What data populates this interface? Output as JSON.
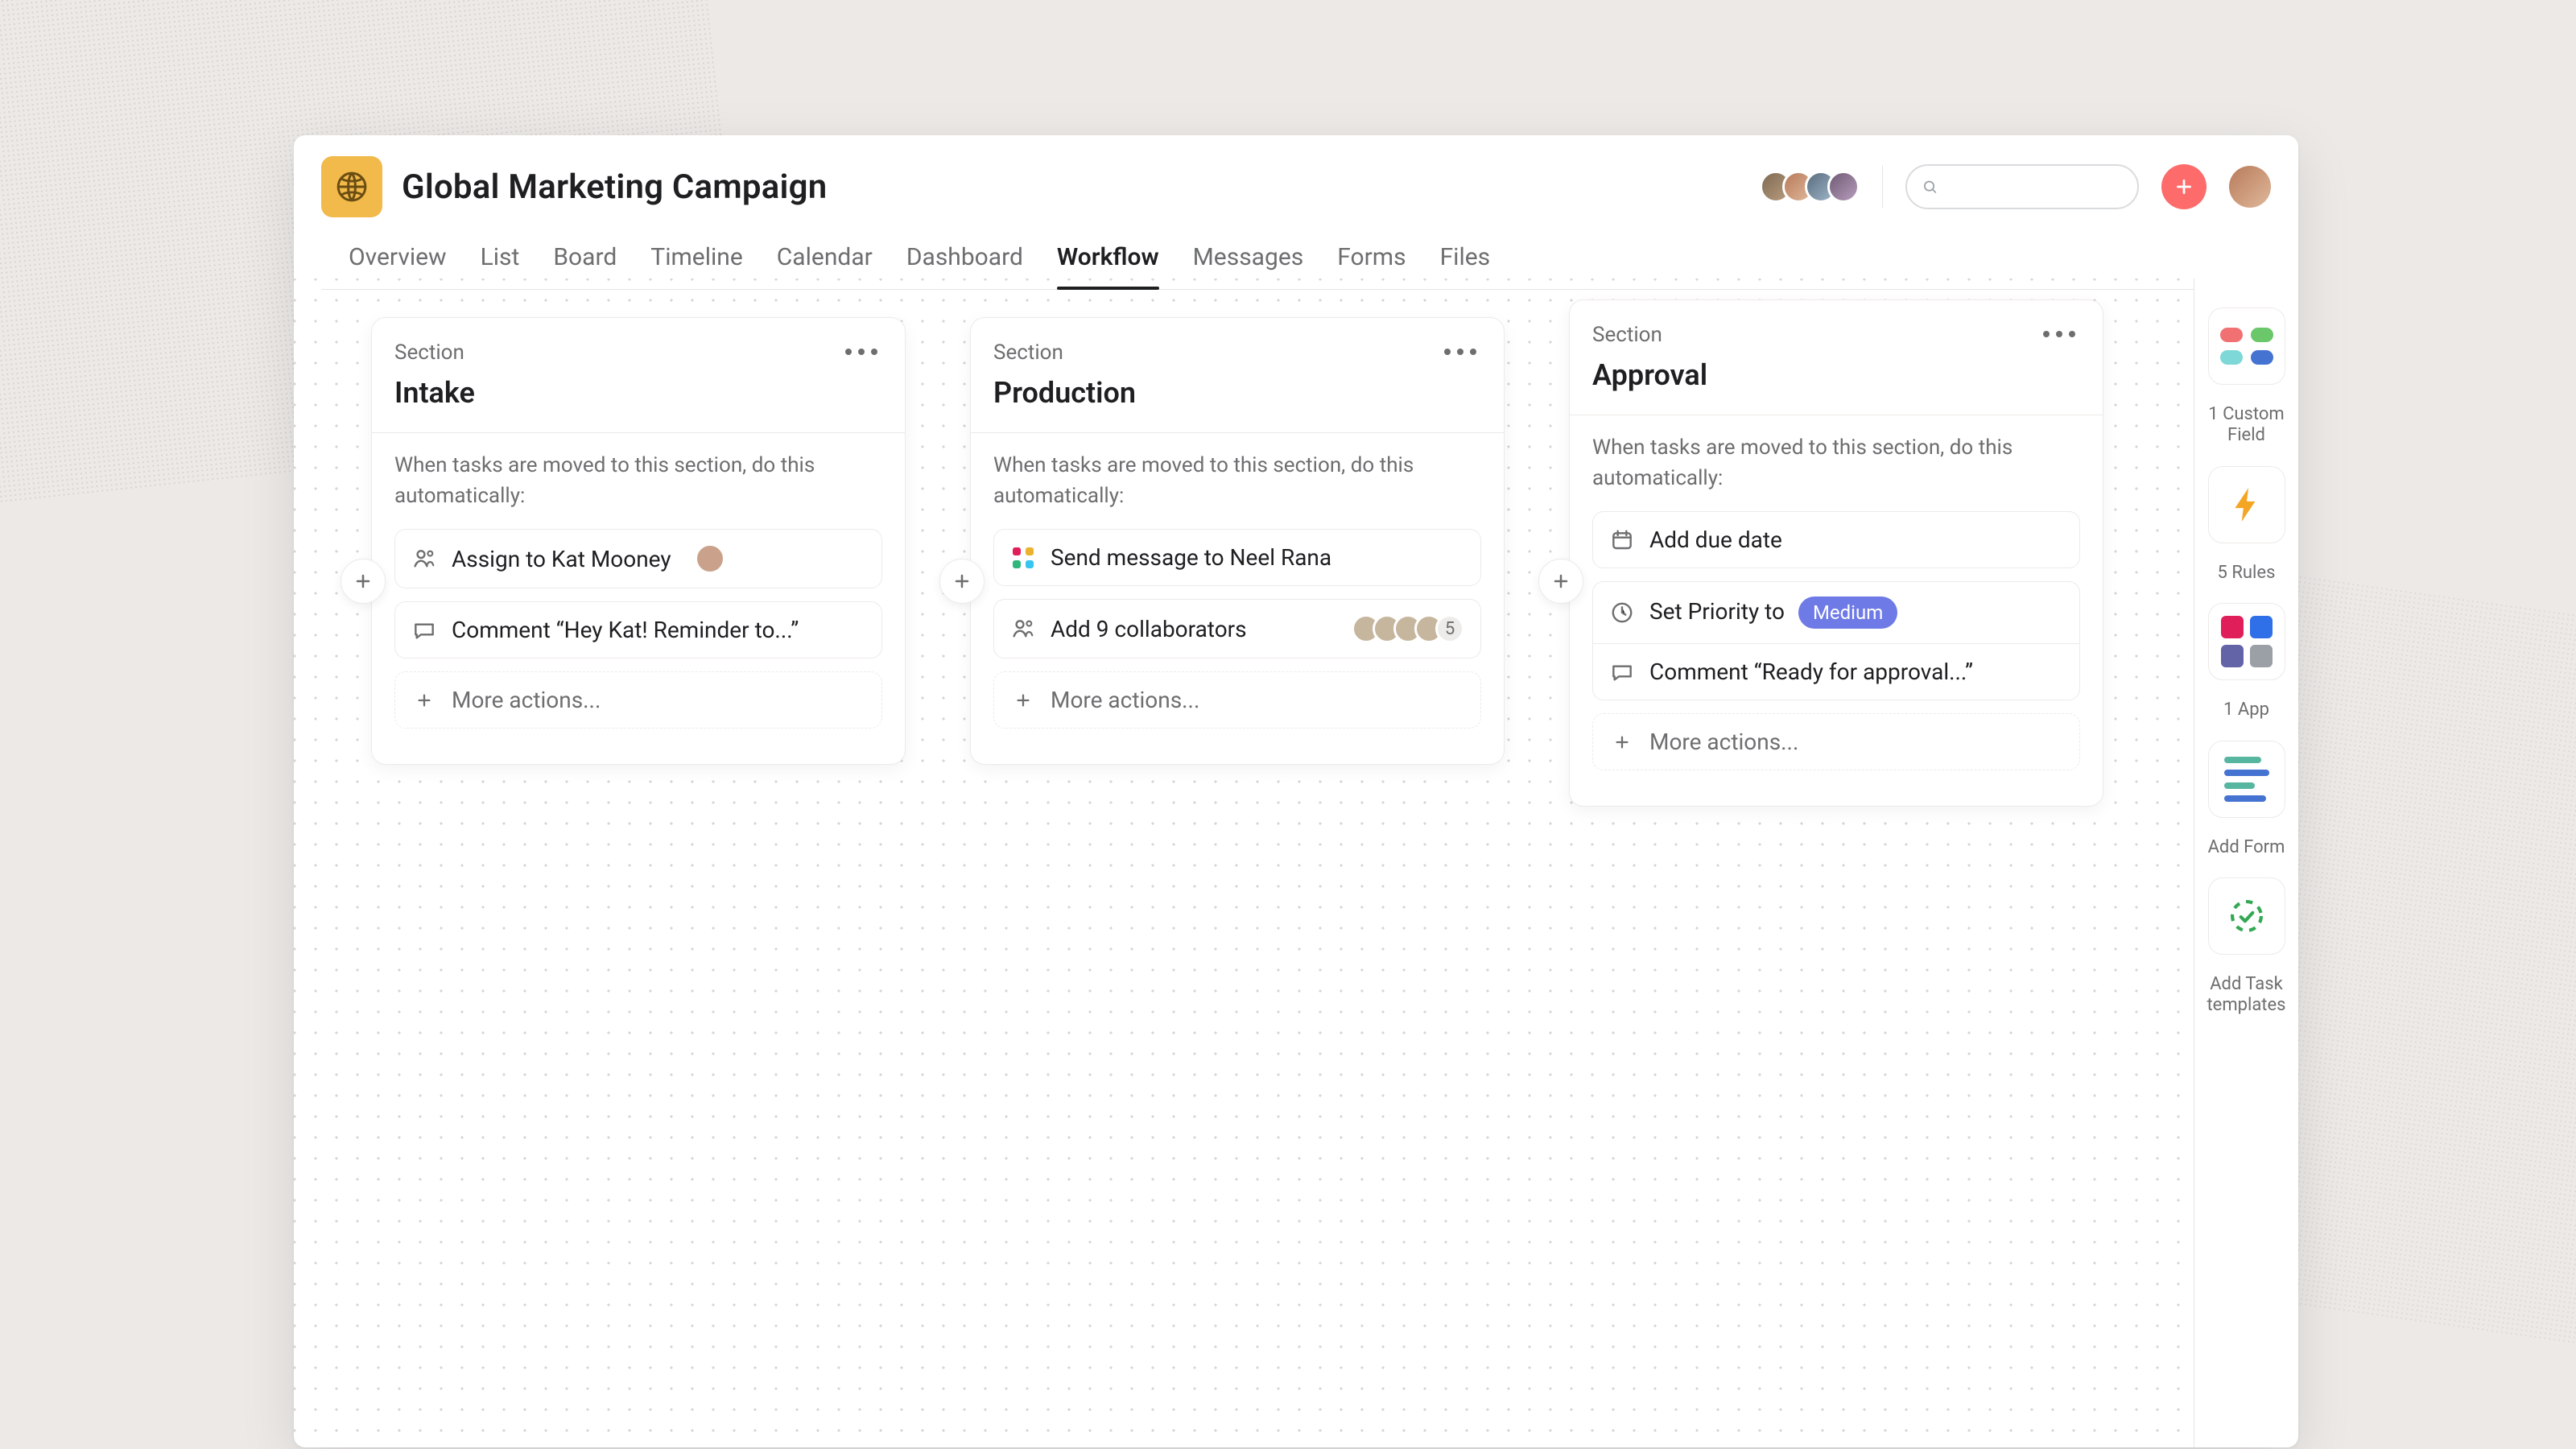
{
  "project": {
    "title": "Global Marketing Campaign",
    "icon": "globe-icon"
  },
  "tabs": [
    {
      "label": "Overview",
      "active": false
    },
    {
      "label": "List",
      "active": false
    },
    {
      "label": "Board",
      "active": false
    },
    {
      "label": "Timeline",
      "active": false
    },
    {
      "label": "Calendar",
      "active": false
    },
    {
      "label": "Dashboard",
      "active": false
    },
    {
      "label": "Workflow",
      "active": true
    },
    {
      "label": "Messages",
      "active": false
    },
    {
      "label": "Forms",
      "active": false
    },
    {
      "label": "Files",
      "active": false
    }
  ],
  "header": {
    "search_placeholder": "",
    "add_button": "add",
    "member_count": 4
  },
  "rail": {
    "custom_field_label": "1 Custom Field",
    "rules_label": "5 Rules",
    "app_label": "1 App",
    "add_form_label": "Add Form",
    "task_templates_label": "Add Task templates"
  },
  "section_kicker": "Section",
  "when_text": "When tasks are moved to this section, do this automatically:",
  "more_actions": "More actions...",
  "sections": [
    {
      "title": "Intake",
      "rules": [
        {
          "icon": "assign-icon",
          "text": "Assign to Kat Mooney",
          "assignee_avatar": true
        },
        {
          "icon": "comment-icon",
          "text": "Comment “Hey Kat! Reminder to...”"
        }
      ]
    },
    {
      "title": "Production",
      "rules": [
        {
          "icon": "slack-icon",
          "text": "Send message to Neel Rana"
        },
        {
          "icon": "collaborators-icon",
          "text": "Add 9 collaborators",
          "avatar_stack": 4,
          "overflow_count": "5"
        }
      ]
    },
    {
      "title": "Approval",
      "rules": [
        {
          "icon": "calendar-icon",
          "text": "Add due date"
        },
        {
          "icon": "priority-icon",
          "text": "Set Priority to",
          "pill": "Medium"
        },
        {
          "icon": "comment-icon",
          "text": "Comment “Ready for approval...”",
          "connected_above": true
        }
      ]
    }
  ],
  "colors": {
    "accent": "#fd6b6b",
    "gold": "#f2b94b",
    "pill": "#6e7ae6",
    "dots": [
      "#f17173",
      "#6ac76a",
      "#7ed8d7",
      "#4573d2"
    ]
  }
}
